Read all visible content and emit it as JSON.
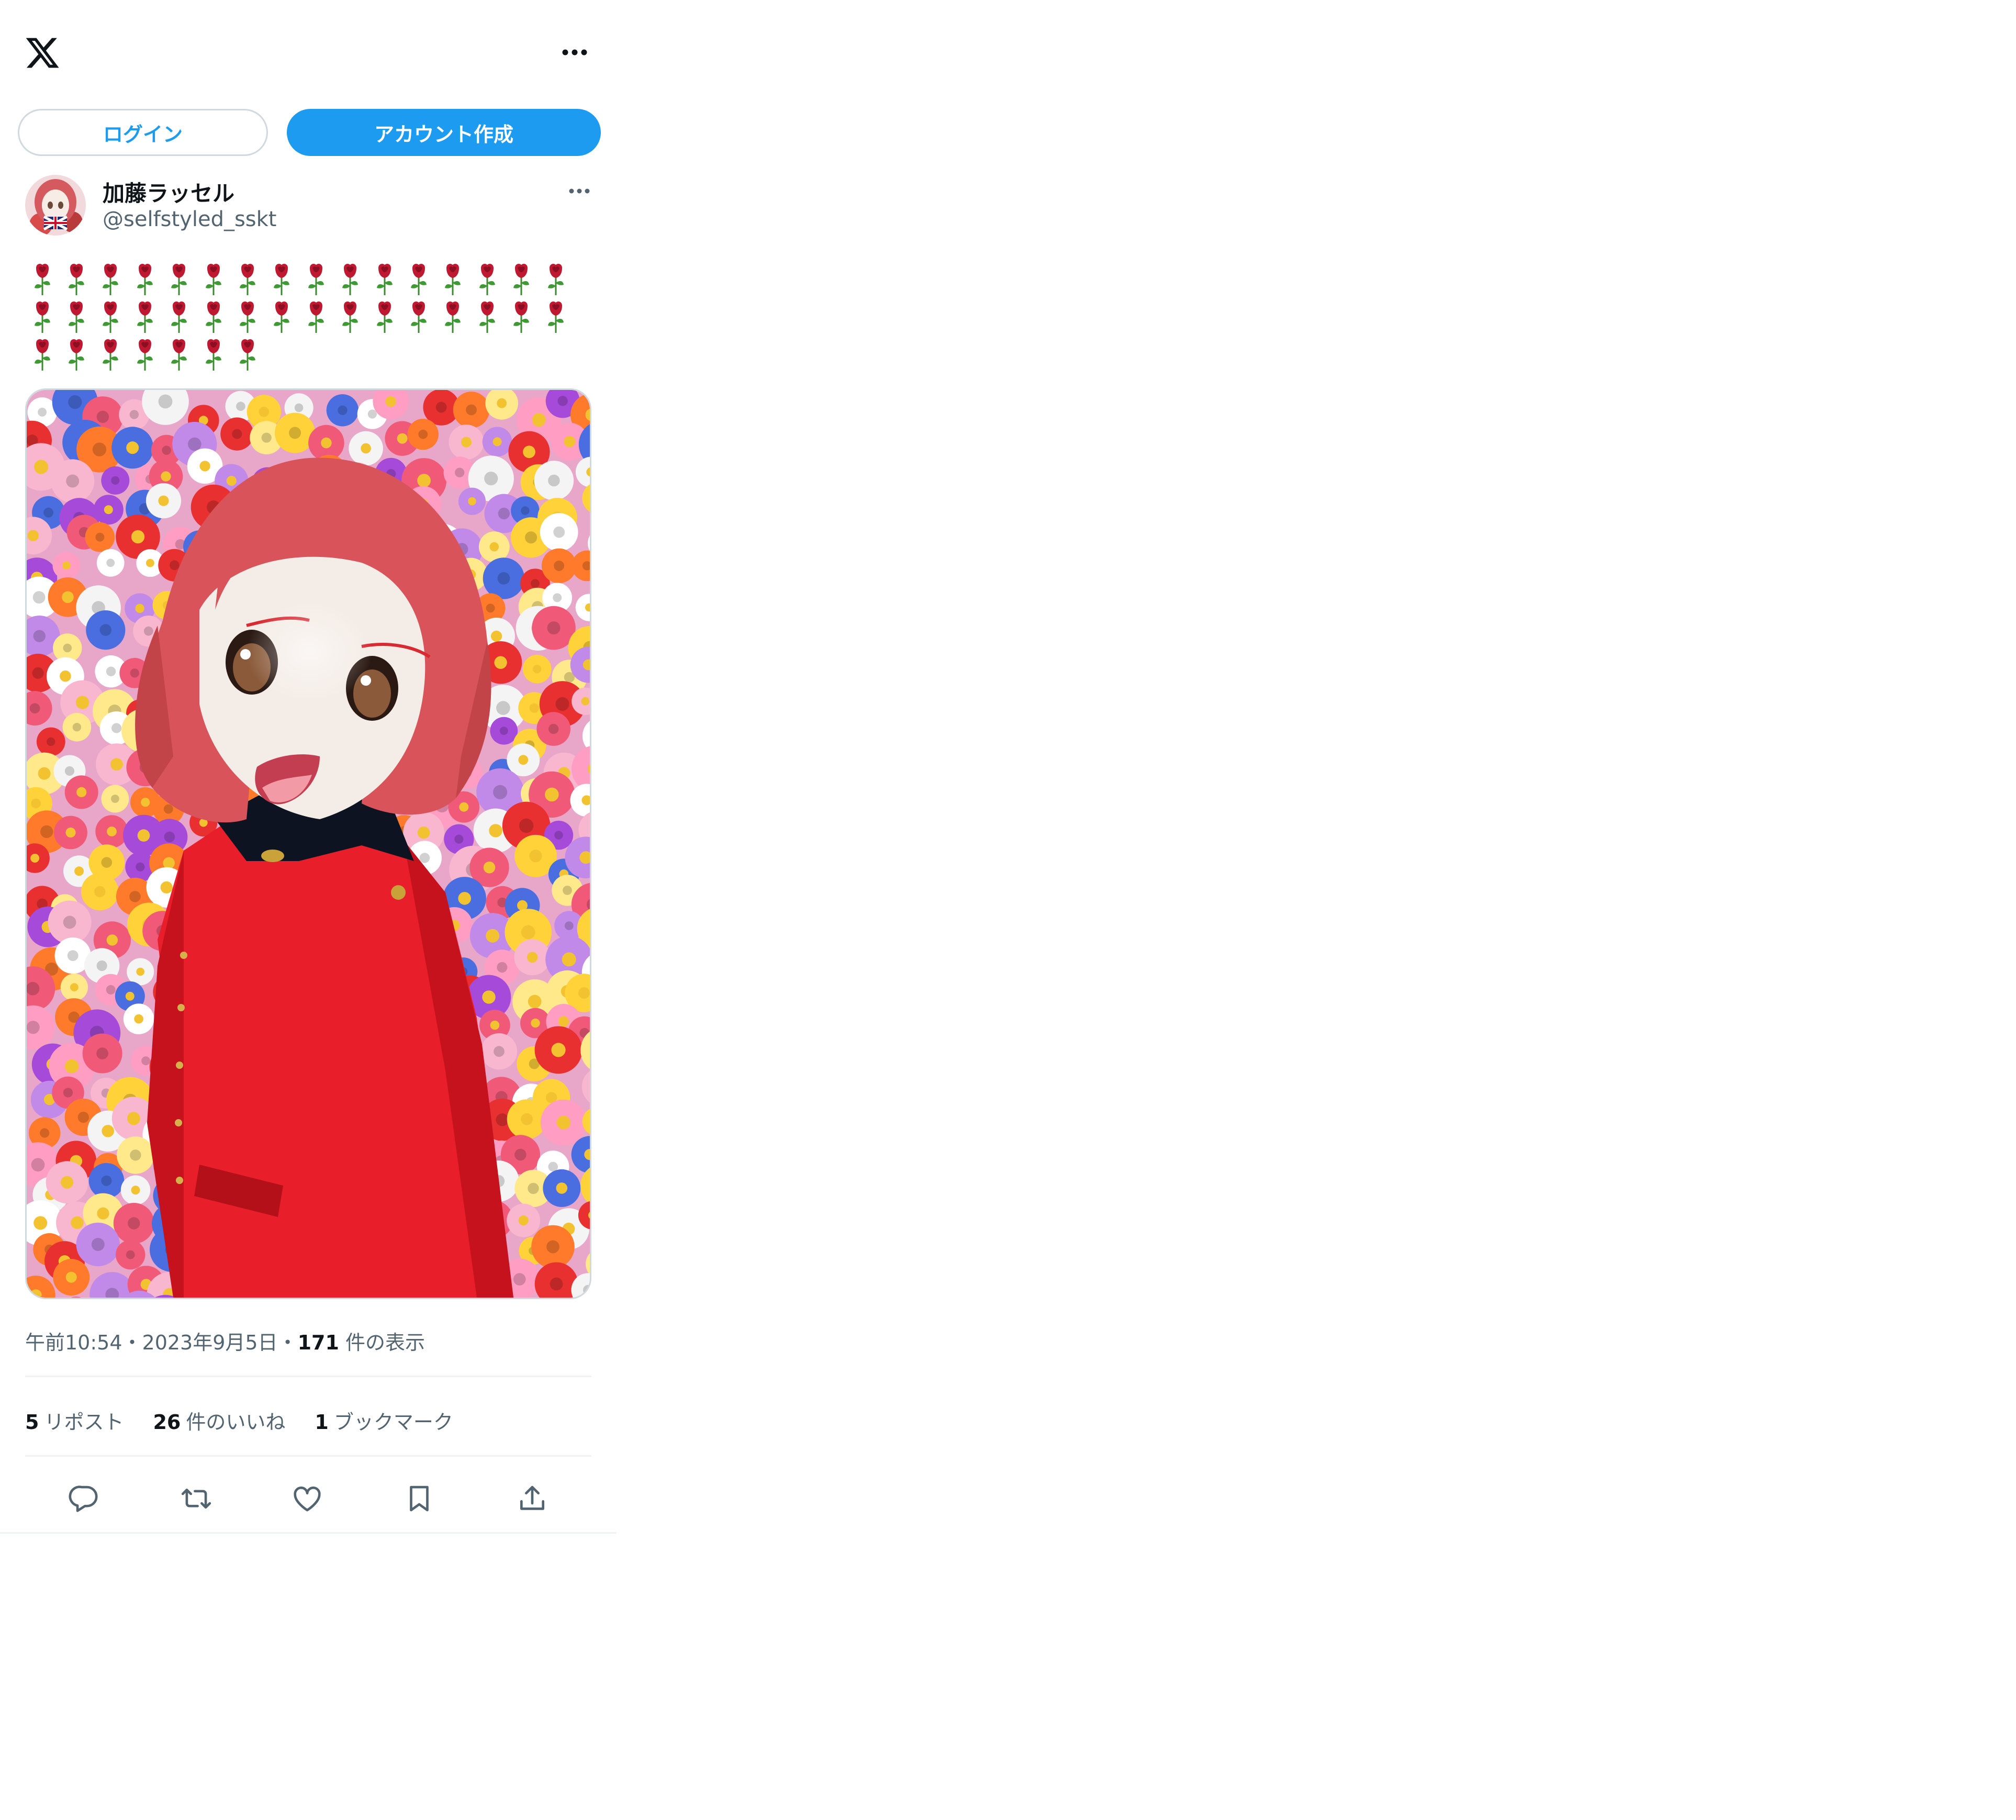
{
  "header": {
    "logo_icon": "x-logo-icon",
    "more_icon": "more-horizontal-icon"
  },
  "auth": {
    "login_label": "ログイン",
    "signup_label": "アカウント作成",
    "accent_color": "#1d9bf0"
  },
  "tweet": {
    "author": {
      "display_name": "加藤ラッセル",
      "handle": "@selfstyled_sskt",
      "avatar_icon": "avatar-image"
    },
    "text_emoji": "🌹",
    "text_rows": [
      16,
      16,
      7
    ],
    "media_icon": "photo-image",
    "time": "午前10:54",
    "date": "2023年9月5日",
    "separator": "・",
    "views_count": "171",
    "views_label": "件の表示",
    "stats": {
      "reposts_count": "5",
      "reposts_label": "リポスト",
      "likes_count": "26",
      "likes_label": "件のいいね",
      "bookmarks_count": "1",
      "bookmarks_label": "ブックマーク"
    },
    "actions": [
      "reply-icon",
      "repost-icon",
      "like-icon",
      "bookmark-icon",
      "share-icon"
    ]
  }
}
